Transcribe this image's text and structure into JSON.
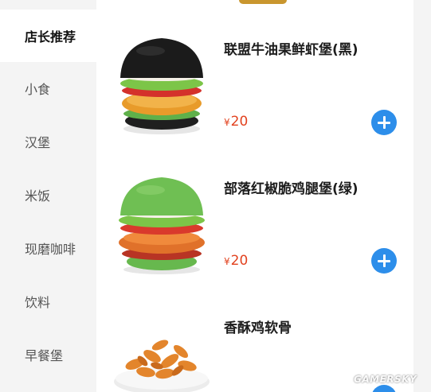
{
  "sidebar": {
    "items": [
      {
        "label": "店长推荐",
        "active": true
      },
      {
        "label": "小食",
        "active": false
      },
      {
        "label": "汉堡",
        "active": false
      },
      {
        "label": "米饭",
        "active": false
      },
      {
        "label": "现磨咖啡",
        "active": false
      },
      {
        "label": "饮料",
        "active": false
      },
      {
        "label": "早餐堡",
        "active": false
      }
    ]
  },
  "menu": {
    "currency": "¥",
    "items": [
      {
        "name": "联盟牛油果鲜虾堡(黑)",
        "price": "20",
        "image": "black-bun-burger"
      },
      {
        "name": "部落红椒脆鸡腿堡(绿)",
        "price": "20",
        "image": "green-bun-burger"
      },
      {
        "name": "香酥鸡软骨",
        "image": "fried-chicken-cartilage"
      }
    ]
  },
  "watermark": "GAMERSKY",
  "colors": {
    "accent": "#2d8eea",
    "price": "#e2421f",
    "sidebar_bg": "#f4f4f4"
  }
}
